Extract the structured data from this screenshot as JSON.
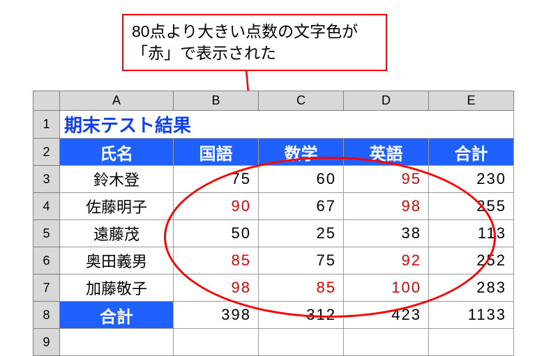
{
  "callout": {
    "text": "80点より大きい点数の文字色が「赤」で表示された"
  },
  "colHeads": [
    "A",
    "B",
    "C",
    "D",
    "E"
  ],
  "rowHeads": [
    "1",
    "2",
    "3",
    "4",
    "5",
    "6",
    "7",
    "8",
    "9"
  ],
  "title": "期末テスト結果",
  "headers": {
    "name": "氏名",
    "kokugo": "国語",
    "sugaku": "数学",
    "eigo": "英語",
    "gokei": "合計"
  },
  "threshold": 80,
  "rows": [
    {
      "name": "鈴木登",
      "kokugo": 75,
      "sugaku": 60,
      "eigo": 95,
      "gokei": 230
    },
    {
      "name": "佐藤明子",
      "kokugo": 90,
      "sugaku": 67,
      "eigo": 98,
      "gokei": 255
    },
    {
      "name": "遠藤茂",
      "kokugo": 50,
      "sugaku": 25,
      "eigo": 38,
      "gokei": 113
    },
    {
      "name": "奥田義男",
      "kokugo": 85,
      "sugaku": 75,
      "eigo": 92,
      "gokei": 252
    },
    {
      "name": "加藤敬子",
      "kokugo": 98,
      "sugaku": 85,
      "eigo": 100,
      "gokei": 283
    }
  ],
  "totals": {
    "label": "合計",
    "kokugo": 398,
    "sugaku": 312,
    "eigo": 423,
    "gokei": 1133
  }
}
